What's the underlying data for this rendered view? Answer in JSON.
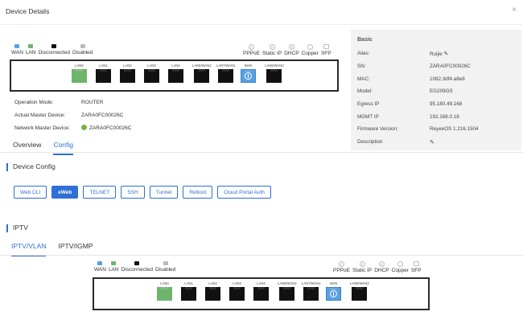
{
  "dialog": {
    "title": "Device Details",
    "close_glyph": "×"
  },
  "legend": {
    "wan": "WAN",
    "lan": "LAN",
    "disconnected": "Disconnected",
    "disabled": "Disabled",
    "pppoe": "PPPoE",
    "static_ip": "Static IP",
    "dhcp": "DHCP",
    "copper": "Copper",
    "sfp": "SFP",
    "colors": {
      "wan": "#5aa0e0",
      "lan": "#6db56d",
      "disconnected": "#111111",
      "disabled": "#bbbbbb"
    }
  },
  "ports": [
    {
      "label": "LAN0",
      "state": "lan-up"
    },
    {
      "label": "LAN1",
      "state": "disconnected"
    },
    {
      "label": "LAN2",
      "state": "disconnected"
    },
    {
      "label": "LAN3",
      "state": "disconnected"
    },
    {
      "label": "LAN4",
      "state": "disconnected"
    },
    {
      "label": "LAN5/WAN2",
      "state": "disconnected"
    },
    {
      "label": "LAN7/WAN1",
      "state": "disconnected"
    },
    {
      "label": "WAN",
      "state": "wan-up"
    },
    {
      "label": "LAN6/WAN3",
      "state": "disconnected"
    }
  ],
  "info": {
    "operation_mode_label": "Operation Mode:",
    "operation_mode": "ROUTER",
    "actual_master_label": "Actual Master Device:",
    "actual_master": "ZARA0FC00026C",
    "network_master_label": "Network Master Device:",
    "network_master": "ZARA0FC00026C"
  },
  "tabs": {
    "overview": "Overview",
    "config": "Config"
  },
  "basic": {
    "heading": "Basic",
    "alias_label": "Alias:",
    "alias": "Ruijie",
    "sn_label": "SN:",
    "sn": "ZARA0FC00026C",
    "mac_label": "MAC:",
    "mac": "1082.3df4.a8e8",
    "model_label": "Model:",
    "model": "EG209GS",
    "egress_label": "Egress IP",
    "egress": "95.180.49.168",
    "mgmt_label": "MGMT IP",
    "mgmt": "192.168.0.18",
    "firmware_label": "Firmware Version:",
    "firmware": "ReyeeOS 1.216.1504",
    "description_label": "Description"
  },
  "device_config": {
    "heading": "Device Config",
    "buttons": [
      "Web CLI",
      "eWeb",
      "TELNET",
      "SSH",
      "Tunnel",
      "Reboot",
      "Cloud Portal Auth"
    ]
  },
  "iptv": {
    "heading": "IPTV",
    "tabs": {
      "vlan": "IPTV/VLAN",
      "igmp": "IPTV/IGMP"
    }
  }
}
